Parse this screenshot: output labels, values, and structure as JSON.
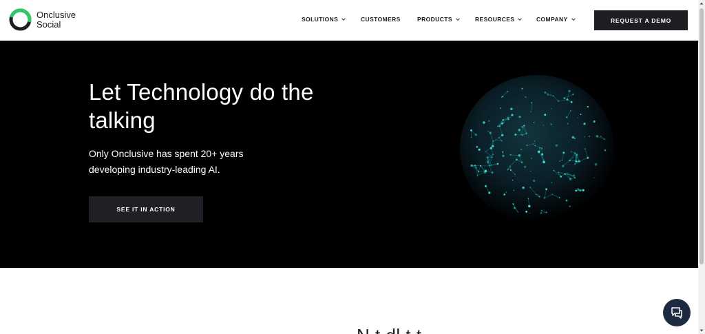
{
  "header": {
    "logo": {
      "line1": "Onclusive",
      "line2": "Social",
      "icon": "ring-logo-icon",
      "ring_color": "#2cc96b"
    },
    "nav": [
      {
        "label": "SOLUTIONS",
        "has_dropdown": true
      },
      {
        "label": "CUSTOMERS",
        "has_dropdown": false
      },
      {
        "label": "PRODUCTS",
        "has_dropdown": true
      },
      {
        "label": "RESOURCES",
        "has_dropdown": true
      },
      {
        "label": "COMPANY",
        "has_dropdown": true
      }
    ],
    "cta_label": "REQUEST A DEMO"
  },
  "hero": {
    "title": "Let Technology do the talking",
    "subtitle": "Only Onclusive has spent 20+ years developing industry-leading AI.",
    "cta_label": "SEE IT IN ACTION",
    "image": "network-globe",
    "accent": "#19c7c7"
  },
  "section": {
    "heading": "N t   dl     t    t"
  },
  "chat": {
    "icon": "chat-bubbles-icon",
    "color": "#1e2a40"
  }
}
